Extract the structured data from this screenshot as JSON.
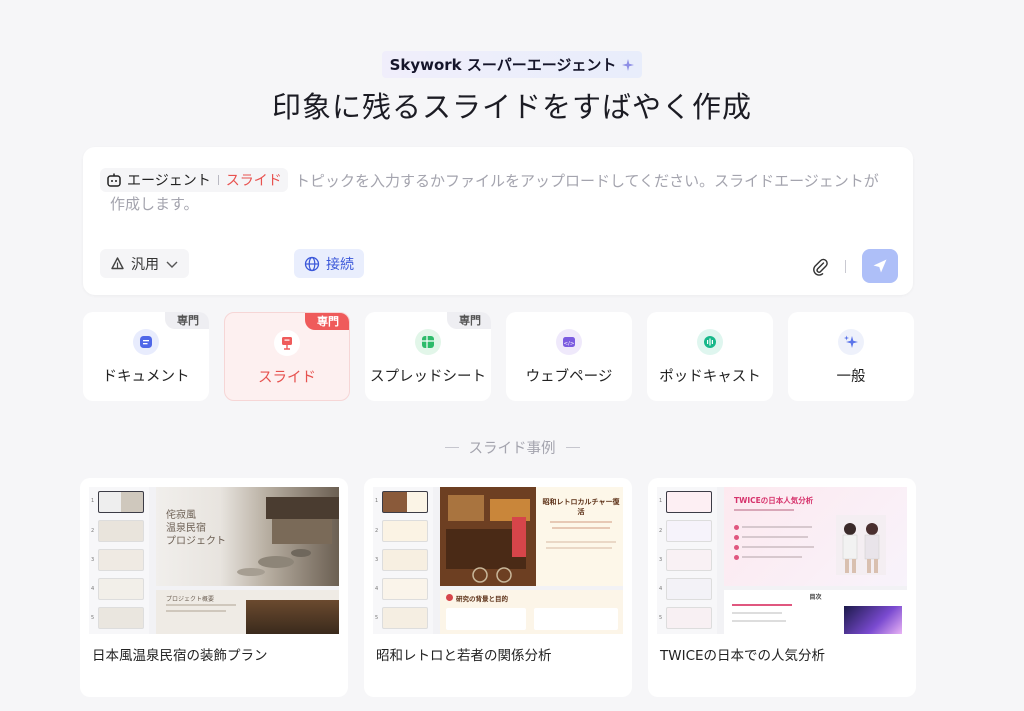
{
  "header": {
    "brand_title": "Skywork スーパーエージェント",
    "headline": "印象に残るスライドをすばやく作成"
  },
  "input": {
    "agent_label": "エージェント",
    "agent_type": "スライド",
    "placeholder": "トピックを入力するかファイルをアップロードしてください。スライドエージェントが作成します。",
    "mode_label": "汎用",
    "connect_label": "接続",
    "colors": {
      "send": "#aebff8",
      "connect_text": "#3a57d9"
    }
  },
  "modes": [
    {
      "label": "ドキュメント",
      "badge": "専門",
      "icon": "document-icon"
    },
    {
      "label": "スライド",
      "badge": "専門",
      "icon": "slide-icon",
      "active": true
    },
    {
      "label": "スプレッドシート",
      "badge": "専門",
      "icon": "spreadsheet-icon"
    },
    {
      "label": "ウェブページ",
      "icon": "webpage-icon"
    },
    {
      "label": "ポッドキャスト",
      "icon": "podcast-icon"
    },
    {
      "label": "一般",
      "icon": "sparkle-icon"
    }
  ],
  "examples_section": {
    "title": "スライド事例",
    "items": [
      {
        "caption": "日本風温泉民宿の装飾プラン",
        "slide_title": "侘寂風\n温泉民宿\nプロジェクト",
        "sub_heading": "プロジェクト概要"
      },
      {
        "caption": "昭和レトロと若者の関係分析",
        "slide_title": "昭和レトロカルチャー復活",
        "sub_heading": "研究の背景と目的"
      },
      {
        "caption": "TWICEの日本での人気分析",
        "slide_title": "TWICEの日本人気分析",
        "sub_heading": "目次"
      }
    ]
  },
  "accent_colors": {
    "slide_red": "#e8524f",
    "badge_red": "#ef5b5b"
  }
}
